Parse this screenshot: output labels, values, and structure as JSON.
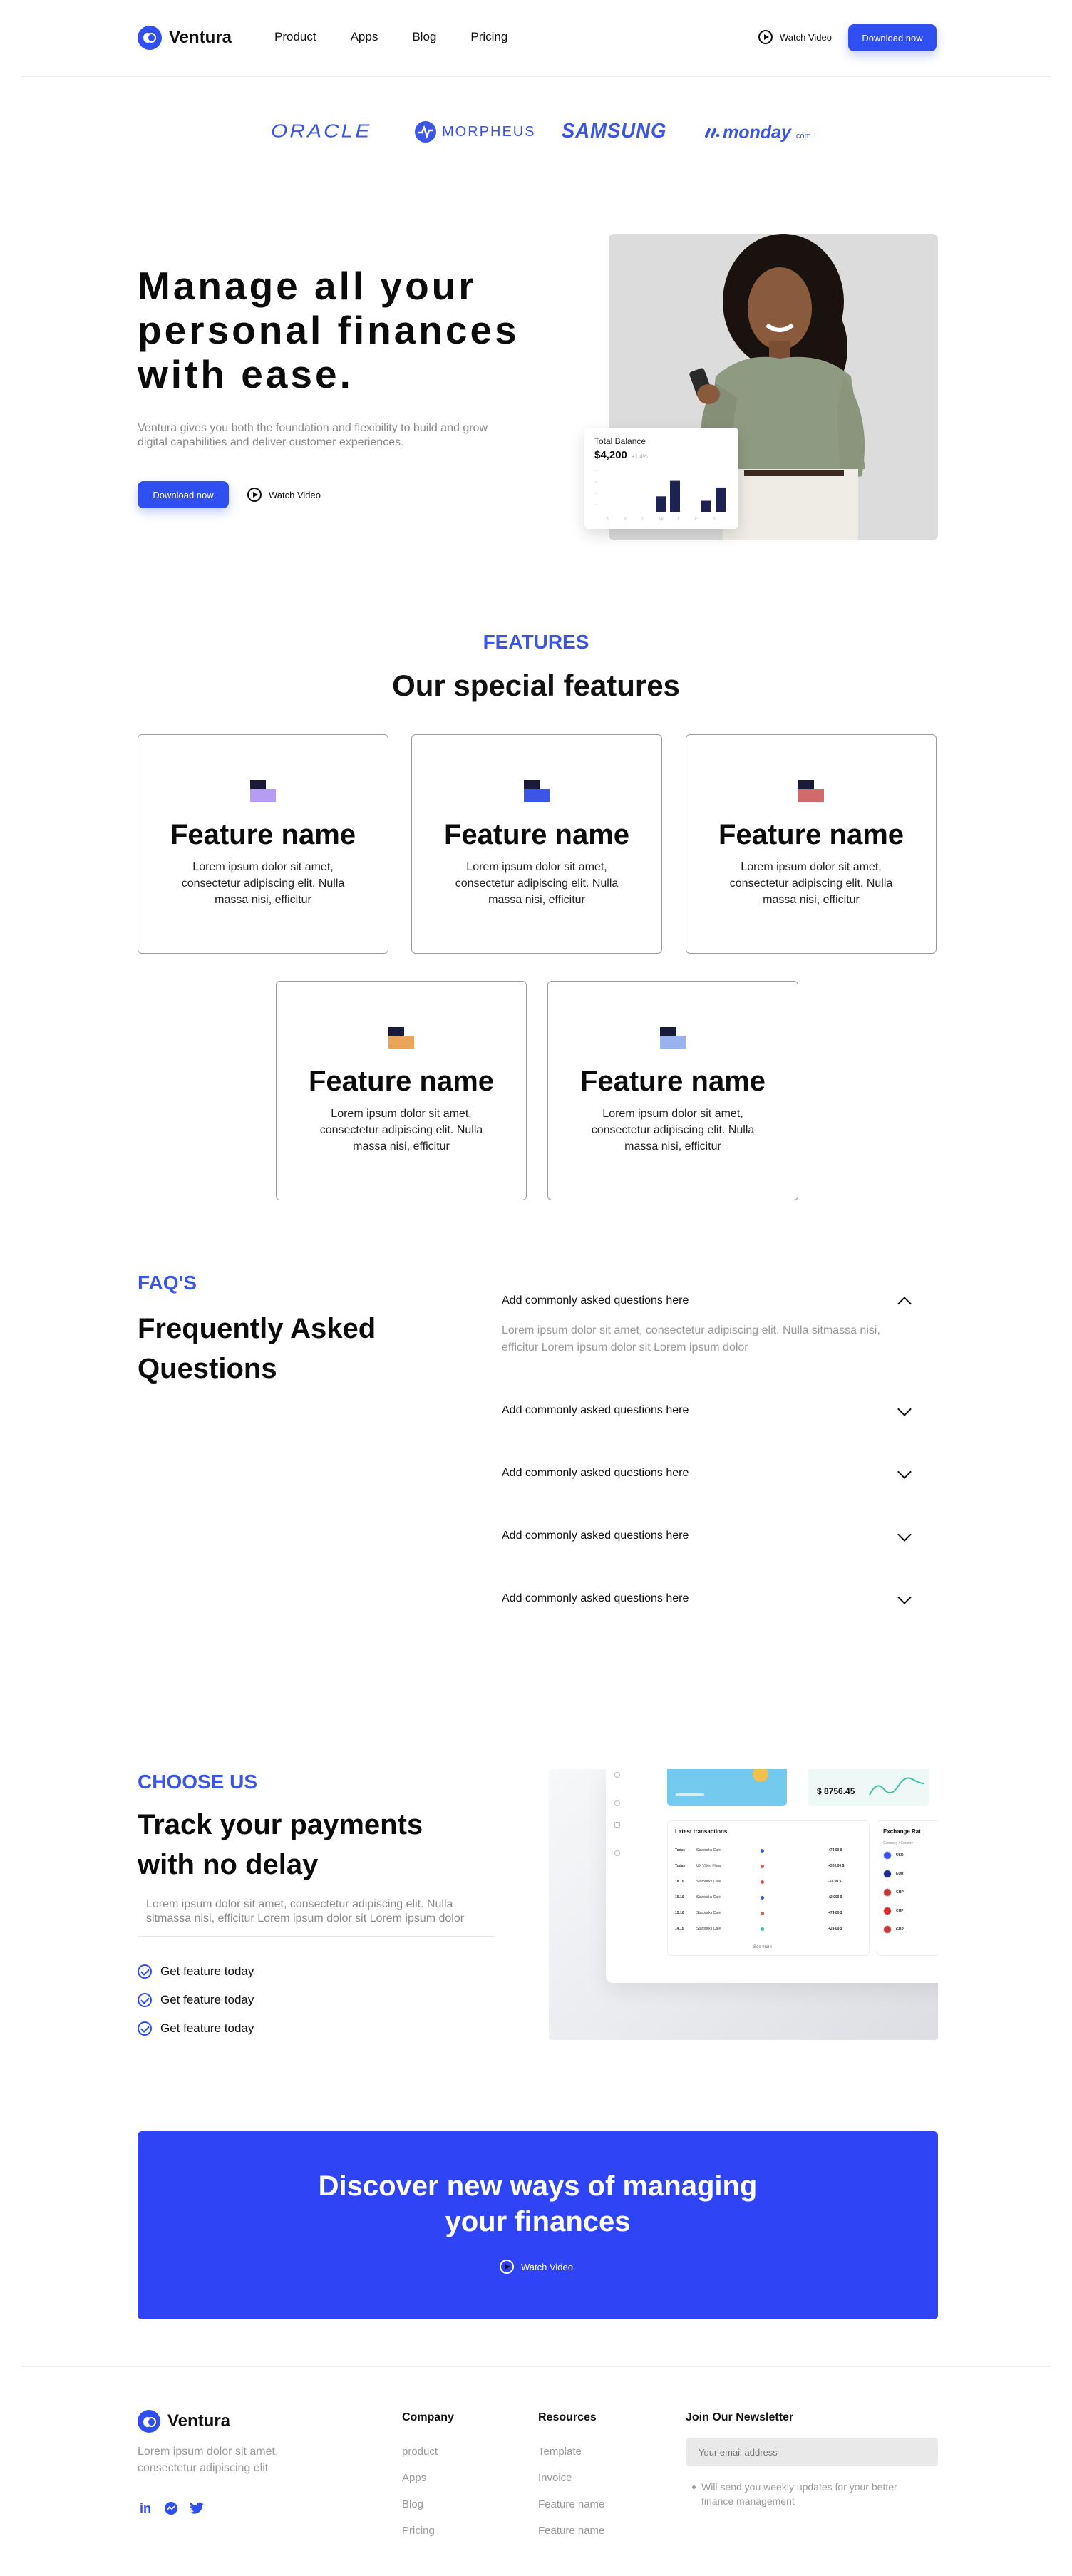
{
  "nav": {
    "brand": "Ventura",
    "links": [
      "Product",
      "Apps",
      "Blog",
      "Pricing"
    ],
    "watch_video": "Watch Video",
    "download": "Download now"
  },
  "partners": [
    "ORACLE",
    "MORPHEUS",
    "SAMSUNG",
    "monday"
  ],
  "partner_suffix": ".com",
  "hero": {
    "title_lines": [
      "Manage all your",
      "personal finances",
      "with ease."
    ],
    "subtitle_lines": [
      "Ventura gives you both the foundation and flexibility to build and grow",
      "digital capabilities and deliver customer experiences."
    ],
    "download": "Download now",
    "watch_video": "Watch Video",
    "balance_card": {
      "title": "Total Balance",
      "amount": "$4,200",
      "change": "+1.4%",
      "bars": [
        0.35,
        0.7,
        0.25,
        0.55,
        0.6
      ],
      "ticks": [
        "S",
        "M",
        "T",
        "W",
        "T",
        "F",
        "S"
      ]
    }
  },
  "features": {
    "kicker": "FEATURES",
    "title": "Our special features",
    "items": [
      {
        "name": "Feature name",
        "desc": "Lorem ipsum dolor sit amet, consectetur adipiscing elit. Nulla massa nisi, efficitur",
        "color": "#b49cf2"
      },
      {
        "name": "Feature name",
        "desc": "Lorem ipsum dolor sit amet, consectetur adipiscing elit. Nulla massa nisi, efficitur",
        "color": "#3b55e6"
      },
      {
        "name": "Feature name",
        "desc": "Lorem ipsum dolor sit amet, consectetur adipiscing elit. Nulla massa nisi, efficitur",
        "color": "#cf6b6b"
      },
      {
        "name": "Feature name",
        "desc": "Lorem ipsum dolor sit amet, consectetur adipiscing elit. Nulla massa nisi, efficitur",
        "color": "#e9a55a"
      },
      {
        "name": "Feature name",
        "desc": "Lorem ipsum dolor sit amet, consectetur adipiscing elit. Nulla massa nisi, efficitur",
        "color": "#98b3ee"
      }
    ]
  },
  "faq": {
    "kicker": "FAQ'S",
    "title_lines": [
      "Frequently Asked",
      "Questions"
    ],
    "items": [
      {
        "q": "Add commonly asked questions here",
        "a_lines": [
          "Lorem ipsum dolor sit amet, consectetur adipiscing elit.  Nulla sitmassa nisi,",
          "efficitur Lorem ipsum dolor sit  Lorem ipsum dolor"
        ],
        "open": true
      },
      {
        "q": "Add commonly asked questions here",
        "open": false
      },
      {
        "q": "Add commonly asked questions here",
        "open": false
      },
      {
        "q": "Add commonly asked questions here",
        "open": false
      },
      {
        "q": "Add commonly asked questions here",
        "open": false
      }
    ]
  },
  "choose": {
    "kicker": "CHOOSE US",
    "title_lines": [
      "Track your payments",
      "with no delay"
    ],
    "desc_lines": [
      "Lorem ipsum dolor sit amet, consectetur adipiscing elit.  Nulla",
      "sitmassa nisi, efficitur Lorem ipsum dolor sit  Lorem ipsum dolor"
    ],
    "checks": [
      "Get feature today",
      "Get feature today",
      "Get feature today"
    ],
    "dashboard": {
      "amount": "$ 8756.45",
      "tx_title": "Latest transactions",
      "rates_title": "Exchange Rat",
      "rates_header": "Currency / Country",
      "see_more": "See more",
      "rows": [
        [
          "Today",
          "Starbucks Cafe",
          "+74.00 $"
        ],
        [
          "Today",
          "UX Video Films",
          "+300.00 $"
        ],
        [
          "18.10",
          "Starbucks Cafe",
          "-14.00 $"
        ],
        [
          "16.10",
          "Starbucks Cafe",
          "+2,000 $"
        ],
        [
          "15.10",
          "Starbucks Cafe",
          "+74.00 $"
        ],
        [
          "14.10",
          "Starbucks Cafe",
          "+24.00 $"
        ]
      ],
      "currencies": [
        "USD",
        "EUR",
        "GBP",
        "CHF",
        "GBP"
      ]
    }
  },
  "cta": {
    "title_lines": [
      "Discover new  ways of managing",
      "your finances"
    ],
    "watch_video": "Watch Video"
  },
  "footer": {
    "brand": "Ventura",
    "about_lines": [
      "Lorem ipsum dolor sit amet,",
      "consectetur adipiscing elit"
    ],
    "company": {
      "title": "Company",
      "links": [
        "product",
        "Apps",
        "Blog",
        "Pricing"
      ]
    },
    "resources": {
      "title": "Resources",
      "links": [
        "Template",
        "Invoice",
        "Feature name",
        "Feature name"
      ]
    },
    "newsletter": {
      "title": "Join Our Newsletter",
      "placeholder": "Your email address",
      "note_lines": [
        "Will send you weekly updates for your better",
        "finance management"
      ]
    }
  }
}
